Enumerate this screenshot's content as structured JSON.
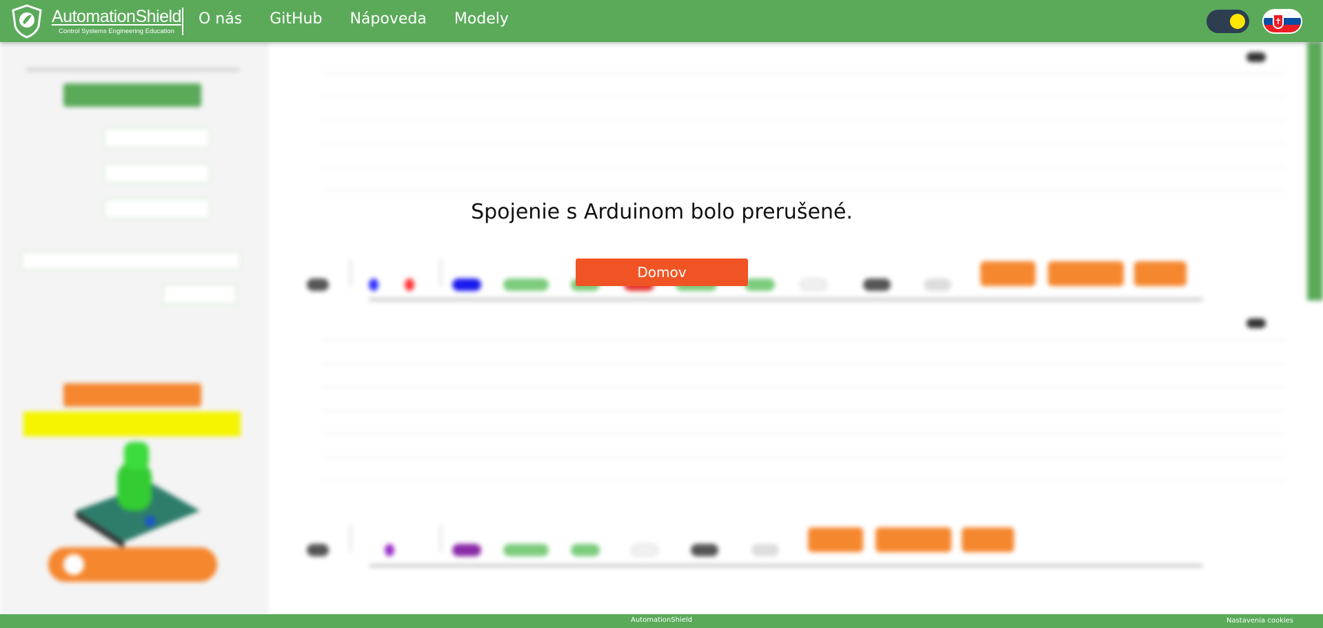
{
  "header": {
    "brand_name": "AutomationShield",
    "brand_subtitle": "Control Systems Engineering Education",
    "nav": [
      "O nás",
      "GitHub",
      "Nápoveda",
      "Modely"
    ],
    "colors": {
      "bar": "#5aaa5a",
      "toggle_bg": "#2c3e50",
      "toggle_knob": "#ffe600"
    },
    "language_flag": "slovak-flag-icon"
  },
  "modal": {
    "message": "Spojenie s Arduinom bolo prerušené.",
    "home_button": "Domov",
    "button_color": "#f15424"
  },
  "footer": {
    "brand": "AutomationShield",
    "cookies": "Nastavenia cookies"
  }
}
